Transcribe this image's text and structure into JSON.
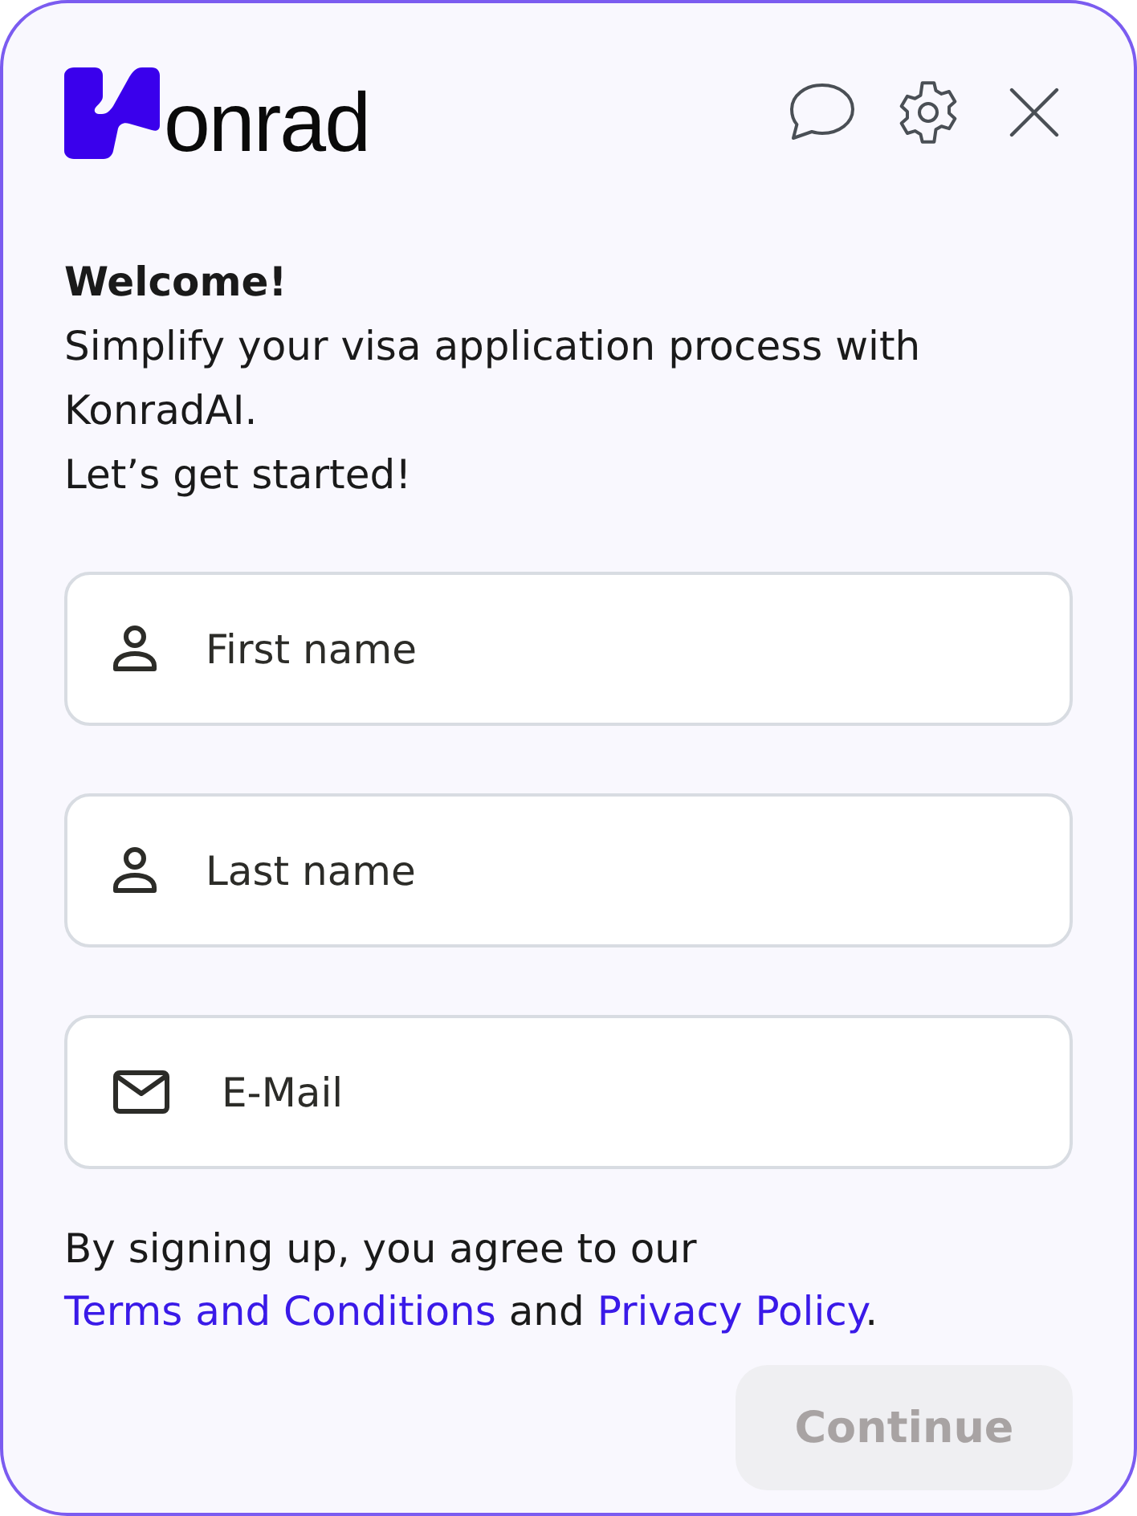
{
  "header": {
    "logo_text": "onrad",
    "actions": [
      {
        "kind": "chat"
      },
      {
        "kind": "settings"
      },
      {
        "kind": "close"
      }
    ]
  },
  "intro": {
    "heading": "Welcome!",
    "lines": [
      "Simplify your visa application process with KonradAI.",
      "Let’s get started!"
    ]
  },
  "fields": [
    {
      "kind": "person",
      "placeholder": "First name"
    },
    {
      "kind": "person",
      "placeholder": "Last name"
    },
    {
      "kind": "mail",
      "placeholder": "E-Mail"
    }
  ],
  "consent": {
    "parts": [
      {
        "kind": "text",
        "text": "By signing up, you agree to our "
      },
      {
        "kind": "link",
        "text": "Terms and Conditions"
      },
      {
        "kind": "text",
        "text": " and "
      },
      {
        "kind": "link",
        "text": "Privacy Policy"
      },
      {
        "kind": "text",
        "text": "."
      }
    ]
  },
  "continue_button": {
    "label": "Continue",
    "disabled": true
  }
}
